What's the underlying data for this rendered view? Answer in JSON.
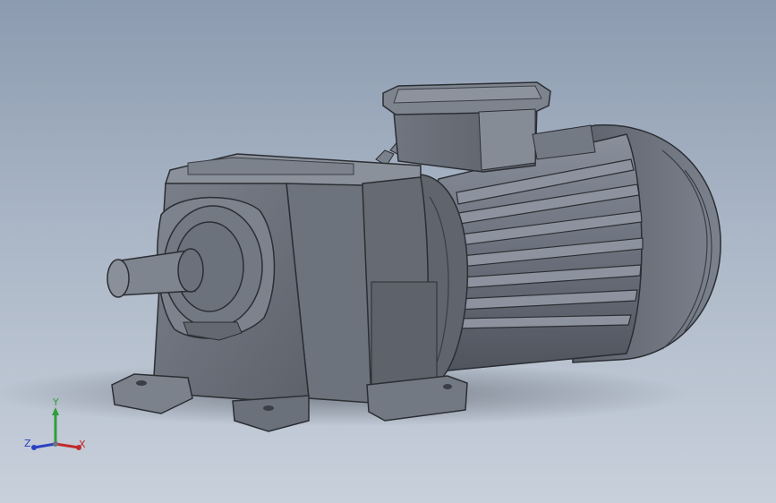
{
  "viewport": {
    "background_top": "#8c9bb0",
    "background_bottom": "#c8d0db"
  },
  "model": {
    "description_icon": "gear-motor-model",
    "body_color": "#6a6f7a"
  },
  "triad": {
    "x_label": "X",
    "y_label": "Y",
    "z_label": "Z",
    "x_color": "#c22a2a",
    "y_color": "#2f9e3a",
    "z_color": "#2a3fc2"
  }
}
